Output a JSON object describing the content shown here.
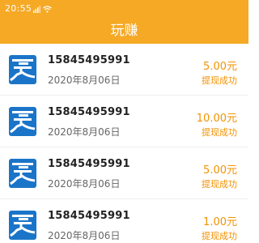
{
  "statusbar": {
    "time": "20:55",
    "icons": [
      "signal-icon",
      "wifi-icon"
    ],
    "bg": "#f6a925"
  },
  "header": {
    "title": "玩赚",
    "bg": "#f6a925"
  },
  "colors": {
    "accent": "#f29200",
    "logo_blue": "#1a75c8"
  },
  "records": [
    {
      "phone": "15845495991",
      "date": "2020年8月06日",
      "amount": "5.00元",
      "status": "提现成功"
    },
    {
      "phone": "15845495991",
      "date": "2020年8月06日",
      "amount": "10.00元",
      "status": "提现成功"
    },
    {
      "phone": "15845495991",
      "date": "2020年8月06日",
      "amount": "5.00元",
      "status": "提现成功"
    },
    {
      "phone": "15845495991",
      "date": "2020年8月06日",
      "amount": "1.00元",
      "status": "提现成功"
    }
  ]
}
